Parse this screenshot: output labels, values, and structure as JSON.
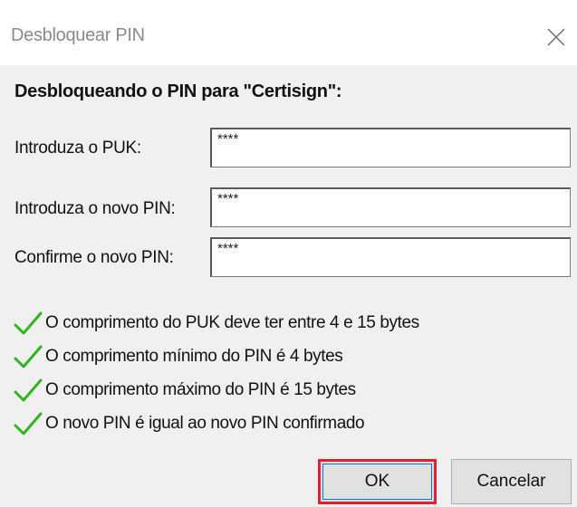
{
  "window": {
    "title": "Desbloquear PIN",
    "close_icon": "close-icon"
  },
  "heading": "Desbloqueando o PIN para \"Certisign\":",
  "fields": [
    {
      "label": "Introduza o PUK:",
      "value": "****"
    },
    {
      "label": "Introduza o novo PIN:",
      "value": "****"
    },
    {
      "label": "Confirme o novo PIN:",
      "value": "****"
    }
  ],
  "rules": [
    {
      "icon": "check-icon",
      "text": "O comprimento do PUK deve ter entre 4 e 15 bytes"
    },
    {
      "icon": "check-icon",
      "text": "O comprimento mínimo do PIN é 4 bytes"
    },
    {
      "icon": "check-icon",
      "text": "O comprimento máximo do PIN é 15 bytes"
    },
    {
      "icon": "check-icon",
      "text": "O novo PIN é igual ao novo PIN confirmado"
    }
  ],
  "buttons": {
    "ok_label": "OK",
    "cancel_label": "Cancelar"
  },
  "colors": {
    "check_green": "#2fb31f",
    "highlight_red": "#e5202e",
    "focus_blue": "#0078d7"
  }
}
